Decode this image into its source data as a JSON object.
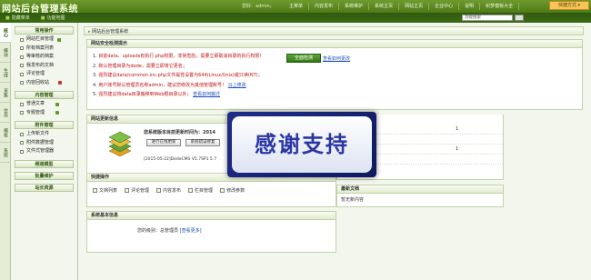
{
  "app": {
    "title": "网站后台管理系统",
    "user_info": "您好：admin，",
    "quick_menu_label": "快捷方式 ▾"
  },
  "top_nav": [
    "主菜单",
    "内容发布",
    "系统维护",
    "系统主页",
    "网站主页",
    "企业中心",
    "说明",
    "织梦模板大全"
  ],
  "sub_bar": {
    "links": [
      "隐藏菜单",
      "功能地图"
    ],
    "search_placeholder": "功能搜索",
    "search_button": "搜"
  },
  "vertical_tabs": [
    "核心",
    "模块",
    "生成",
    "采集",
    "会员",
    "模板",
    "系统"
  ],
  "sidebar": {
    "sections": [
      {
        "title": "常用操作",
        "items": [
          {
            "label": "网站栏目管理",
            "flag": "green"
          },
          {
            "label": "所有档案列表",
            "flag": ""
          },
          {
            "label": "等审核的档案",
            "flag": ""
          },
          {
            "label": "我发布的文档",
            "flag": ""
          },
          {
            "label": "评论管理",
            "flag": ""
          },
          {
            "label": "内容回收站",
            "flag": "red"
          }
        ]
      },
      {
        "title": "内容管理",
        "items": [
          {
            "label": "普通文章",
            "flag": "green"
          },
          {
            "label": "专题管理",
            "flag": "green"
          }
        ]
      },
      {
        "title": "附件管理",
        "items": [
          {
            "label": "上传新文件",
            "flag": ""
          },
          {
            "label": "附件数据管理",
            "flag": ""
          },
          {
            "label": "文件式管理器",
            "flag": ""
          }
        ]
      },
      {
        "title": "频道模型",
        "items": []
      },
      {
        "title": "批量维护",
        "items": []
      },
      {
        "title": "站长资源",
        "items": []
      }
    ]
  },
  "breadcrumb": "网站后台管理系统",
  "warning_panel": {
    "title": "网站安全检测提示",
    "scan_button": "全面检测",
    "scan_link": "查看如何更改",
    "lines": [
      {
        "num": "1.",
        "text": "目前data、uploads有执行.php权限，非常危险，需要立即取消目录的执行权限！",
        "link": ""
      },
      {
        "num": "2.",
        "text": "默认管理目录为dede，需要立即将它更名；",
        "link": ""
      },
      {
        "num": "3.",
        "text": "强烈建议data/common.inc.php文件属性设置为644(Linux/Unix)或只读(NT)；",
        "link": ""
      },
      {
        "num": "4.",
        "text": "用户账号默认管理员名称admin，建议您修改为其他管理账号！",
        "link": "马上修改"
      },
      {
        "num": "5.",
        "text": "强烈建议将data目录搬移到Web根目录以外；",
        "link": "查看如何搬迁"
      }
    ]
  },
  "update_panel": {
    "title": "网站更新信息",
    "version_text": "您系统版本目前更新时间为：2014",
    "btn_check": "进行在线更新",
    "btn_log": "系统错误修复",
    "log_line": "[2015-05-22]DedeCMS V5.7SP1 5.7"
  },
  "stats_panel": {
    "rows": [
      {
        "label": "",
        "value": "1"
      },
      {
        "label": "",
        "value": ""
      },
      {
        "label": "",
        "value": "1"
      },
      {
        "label": "",
        "value": ""
      }
    ]
  },
  "quick_panel": {
    "title": "快捷操作",
    "items": [
      "文档列表",
      "评论管理",
      "内容发布",
      "栏目管理",
      "修改参数"
    ]
  },
  "news_panel": {
    "title": "最新文档",
    "body": "暂无新内容"
  },
  "sysinfo_panel": {
    "title": "系统基本信息",
    "level_label": "您的级别：",
    "level_value": "总管理员",
    "more_link": "[查看更多]"
  },
  "overlay": {
    "text": "感谢支持"
  }
}
